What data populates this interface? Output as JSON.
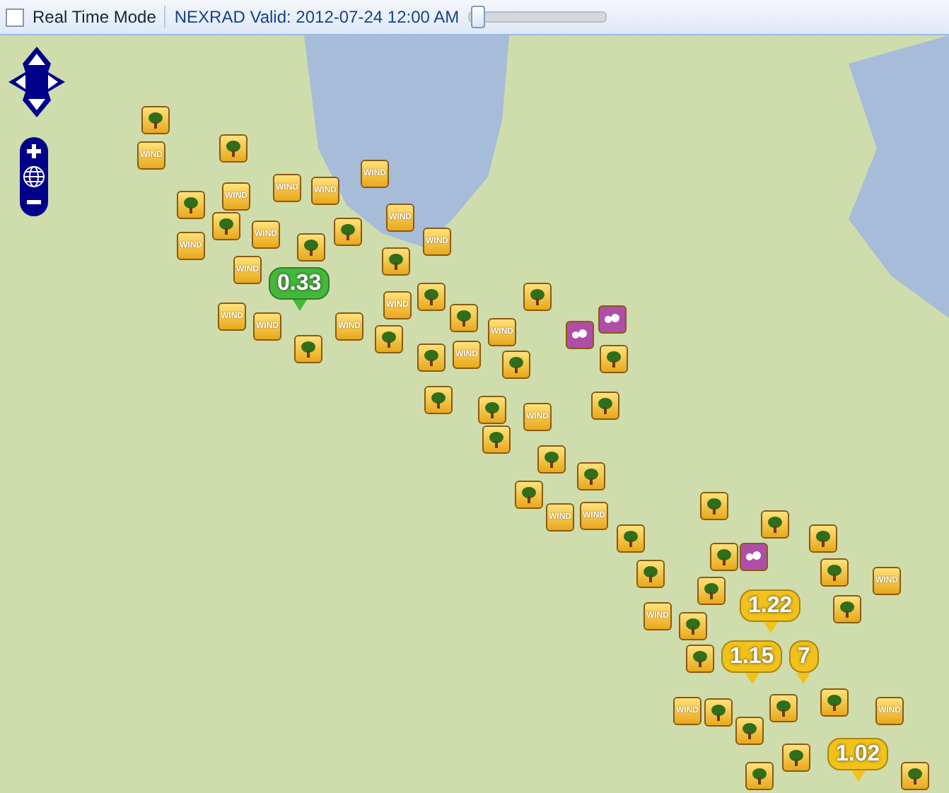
{
  "toolbar": {
    "real_time_mode": {
      "label": "Real Time Mode",
      "checked": false
    },
    "valid_time": "NEXRAD Valid: 2012-07-24 12:00 AM",
    "time_slider": {
      "level": 0.02
    }
  },
  "markers": [
    {
      "kind": "tree"
    },
    {
      "kind": "tree"
    },
    {
      "kind": "tree"
    },
    {
      "kind": "tree"
    },
    {
      "kind": "tree"
    },
    {
      "kind": "tree"
    },
    {
      "kind": "tree"
    },
    {
      "kind": "tree"
    },
    {
      "kind": "tree"
    },
    {
      "kind": "tree"
    },
    {
      "kind": "tree"
    },
    {
      "kind": "tree"
    },
    {
      "kind": "tree"
    },
    {
      "kind": "tree"
    },
    {
      "kind": "tree"
    },
    {
      "kind": "tree"
    },
    {
      "kind": "tree"
    },
    {
      "kind": "tree"
    },
    {
      "kind": "tree"
    },
    {
      "kind": "tree"
    },
    {
      "kind": "tree"
    },
    {
      "kind": "tree"
    },
    {
      "kind": "tree"
    },
    {
      "kind": "tree"
    },
    {
      "kind": "tree"
    },
    {
      "kind": "tree"
    },
    {
      "kind": "tree"
    },
    {
      "kind": "tree"
    },
    {
      "kind": "tree"
    },
    {
      "kind": "tree"
    },
    {
      "kind": "tree"
    },
    {
      "kind": "tree"
    },
    {
      "kind": "tree"
    },
    {
      "kind": "tree"
    },
    {
      "kind": "tree"
    },
    {
      "kind": "tree"
    },
    {
      "kind": "tree"
    },
    {
      "kind": "tree"
    },
    {
      "kind": "tree"
    },
    {
      "kind": "tree"
    },
    {
      "kind": "wind",
      "label": "WIND"
    },
    {
      "kind": "wind",
      "label": "WIND"
    },
    {
      "kind": "wind",
      "label": "WIND"
    },
    {
      "kind": "wind",
      "label": "WIND"
    },
    {
      "kind": "wind",
      "label": "WIND"
    },
    {
      "kind": "wind",
      "label": "WIND"
    },
    {
      "kind": "wind",
      "label": "WIND"
    },
    {
      "kind": "wind",
      "label": "WIND"
    },
    {
      "kind": "wind",
      "label": "WIND"
    },
    {
      "kind": "wind",
      "label": "WIND"
    },
    {
      "kind": "wind",
      "label": "WIND"
    },
    {
      "kind": "wind",
      "label": "WIND"
    },
    {
      "kind": "wind",
      "label": "WIND"
    },
    {
      "kind": "wind",
      "label": "WIND"
    },
    {
      "kind": "wind",
      "label": "WIND"
    },
    {
      "kind": "wind",
      "label": "WIND"
    },
    {
      "kind": "wind",
      "label": "WIND"
    },
    {
      "kind": "wind",
      "label": "WIND"
    },
    {
      "kind": "wind",
      "label": "WIND"
    },
    {
      "kind": "wind",
      "label": "WIND"
    },
    {
      "kind": "wind",
      "label": "WIND"
    },
    {
      "kind": "wind",
      "label": "WIND"
    },
    {
      "kind": "wind",
      "label": "WIND"
    },
    {
      "kind": "hail"
    },
    {
      "kind": "hail"
    },
    {
      "kind": "hail"
    }
  ],
  "callouts": [
    {
      "value": "0.33",
      "color": "#44b83a"
    },
    {
      "value": "1.22",
      "color": "#f2c21b"
    },
    {
      "value": "7",
      "color": "#f2c21b"
    },
    {
      "value": "1.15",
      "color": "#f2c21b"
    },
    {
      "value": "1.02",
      "color": "#f2c21b"
    }
  ]
}
